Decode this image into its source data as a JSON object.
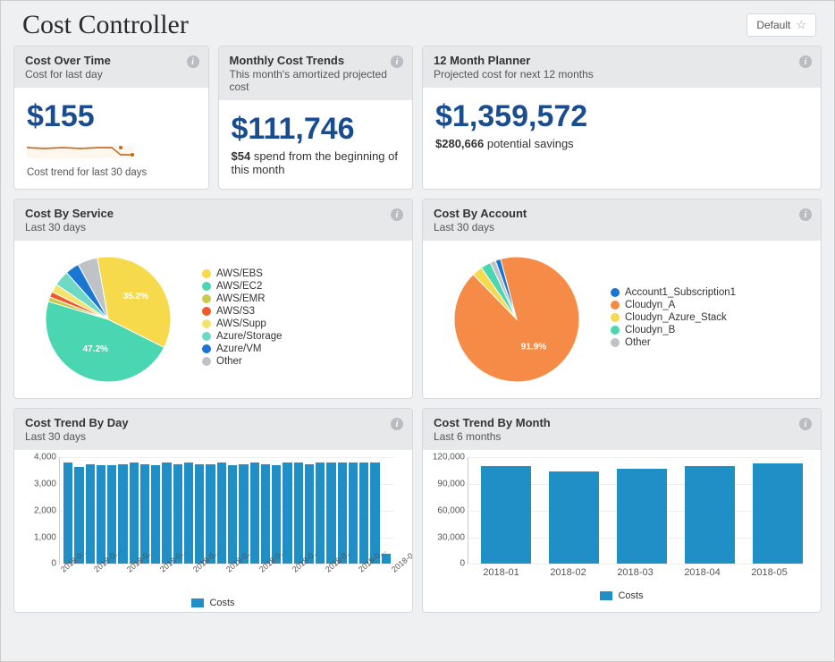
{
  "header": {
    "title": "Cost Controller",
    "default_button": "Default"
  },
  "cards": {
    "cost_over_time": {
      "title": "Cost Over Time",
      "subtitle": "Cost for last day",
      "value": "$155",
      "sparkline_caption": "Cost trend for last 30 days"
    },
    "monthly_trends": {
      "title": "Monthly Cost Trends",
      "subtitle": "This month's amortized projected cost",
      "value": "$111,746",
      "sub_bold": "$54",
      "sub_rest": " spend from the beginning of this month"
    },
    "planner": {
      "title": "12 Month Planner",
      "subtitle": "Projected cost for next 12 months",
      "value": "$1,359,572",
      "sub_bold": "$280,666",
      "sub_rest": " potential savings"
    },
    "cost_by_service": {
      "title": "Cost By Service",
      "subtitle": "Last 30 days"
    },
    "cost_by_account": {
      "title": "Cost By Account",
      "subtitle": "Last 30 days"
    },
    "cost_trend_day": {
      "title": "Cost Trend By Day",
      "subtitle": "Last 30 days",
      "legend": "Costs"
    },
    "cost_trend_month": {
      "title": "Cost Trend By Month",
      "subtitle": "Last 6 months",
      "legend": "Costs"
    }
  },
  "chart_data": [
    {
      "id": "cost_by_service",
      "type": "pie",
      "series": [
        {
          "name": "AWS/EBS",
          "value": 35.2,
          "color": "#f7d94c"
        },
        {
          "name": "AWS/EC2",
          "value": 47.2,
          "color": "#49d6b0"
        },
        {
          "name": "AWS/EMR",
          "value": 1.2,
          "color": "#c9cc4a"
        },
        {
          "name": "AWS/S3",
          "value": 1.4,
          "color": "#f05a2a"
        },
        {
          "name": "AWS/Supp",
          "value": 2.2,
          "color": "#f2e36b"
        },
        {
          "name": "Azure/Storage",
          "value": 4.0,
          "color": "#6fd9c3"
        },
        {
          "name": "Azure/VM",
          "value": 3.6,
          "color": "#1976d2"
        },
        {
          "name": "Other",
          "value": 5.2,
          "color": "#bfc3c7"
        }
      ],
      "labels_shown": [
        "47.2%",
        "35.2%"
      ]
    },
    {
      "id": "cost_by_account",
      "type": "pie",
      "series": [
        {
          "name": "Account1_Subscription1",
          "value": 1.4,
          "color": "#1976d2"
        },
        {
          "name": "Cloudyn_A",
          "value": 91.9,
          "color": "#f58b46"
        },
        {
          "name": "Cloudyn_Azure_Stack",
          "value": 2.7,
          "color": "#f7d94c"
        },
        {
          "name": "Cloudyn_B",
          "value": 2.6,
          "color": "#49d6b0"
        },
        {
          "name": "Other",
          "value": 1.4,
          "color": "#bfc3c7"
        }
      ],
      "labels_shown": [
        "91.9%"
      ]
    },
    {
      "id": "cost_trend_day",
      "type": "bar",
      "ylabel": "",
      "xlabel": "",
      "ylim": [
        0,
        4000
      ],
      "yticks": [
        0,
        1000,
        2000,
        3000,
        4000
      ],
      "categories": [
        "2018-0…",
        "2018-0…",
        "2018-0…",
        "2018-0…",
        "2018-0…",
        "2018-0…",
        "2018-0…",
        "2018-0…",
        "2018-0…",
        "2018-0…",
        "2018-0…",
        "2018-0…",
        "2018-0…",
        "2018-0…",
        "2018-0…"
      ],
      "values": [
        3800,
        3650,
        3750,
        3700,
        3700,
        3750,
        3800,
        3750,
        3700,
        3800,
        3750,
        3800,
        3750,
        3750,
        3800,
        3700,
        3750,
        3800,
        3750,
        3700,
        3800,
        3800,
        3750,
        3800,
        3800,
        3800,
        3800,
        3800,
        3800,
        400
      ],
      "legend": "Costs"
    },
    {
      "id": "cost_trend_month",
      "type": "bar",
      "ylabel": "",
      "xlabel": "",
      "ylim": [
        0,
        120000
      ],
      "yticks": [
        0,
        30000,
        60000,
        90000,
        120000
      ],
      "categories": [
        "2018-01",
        "2018-02",
        "2018-03",
        "2018-04",
        "2018-05"
      ],
      "values": [
        110000,
        104000,
        107000,
        110000,
        113000
      ],
      "legend": "Costs"
    }
  ]
}
